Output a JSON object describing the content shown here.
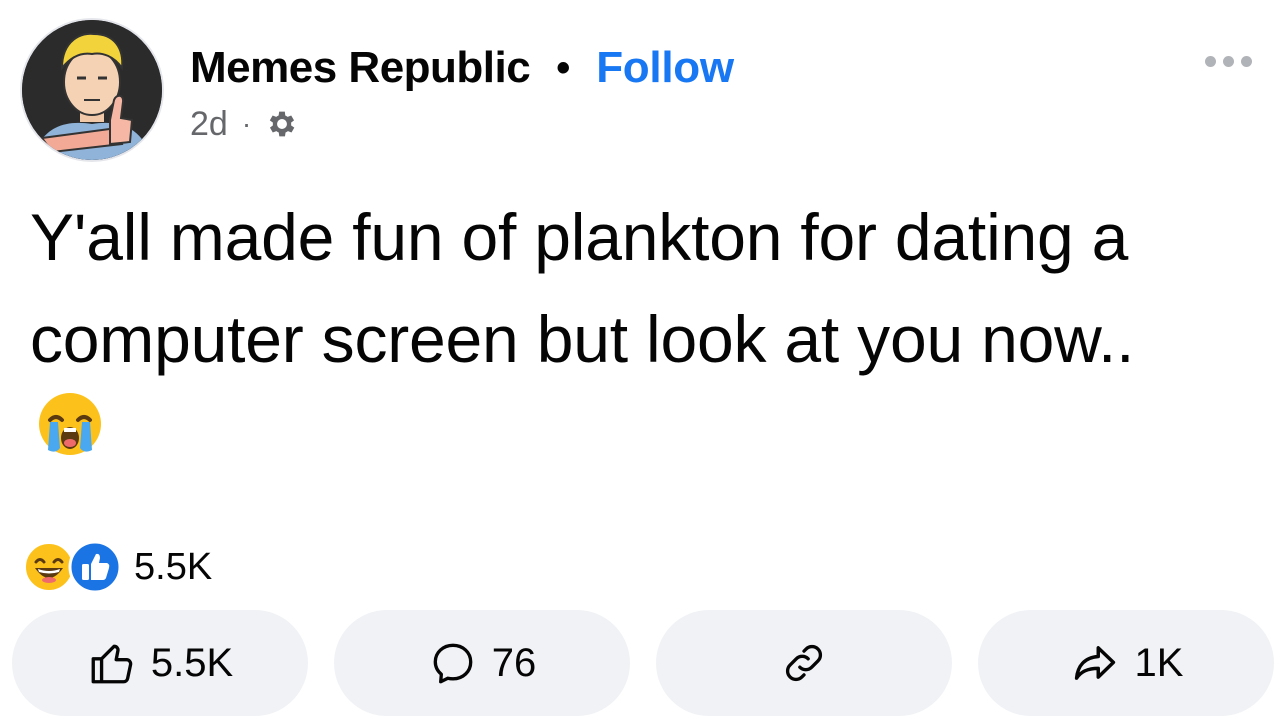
{
  "post": {
    "page_name": "Memes Republic",
    "separator": "•",
    "follow_label": "Follow",
    "time": "2d",
    "meta_separator": "·",
    "audience_icon": "gear-icon",
    "text_line1": "Y'all made fun of plankton for dating a",
    "text_line2": "computer screen but look at you now..",
    "emoji": "loudly-crying-face-emoji"
  },
  "reactions": {
    "icons": [
      "laughing-face-icon",
      "like-thumb-icon"
    ],
    "count": "5.5K"
  },
  "actions": [
    {
      "icon": "like-outline-icon",
      "label": "5.5K"
    },
    {
      "icon": "comment-bubble-icon",
      "label": "76"
    },
    {
      "icon": "link-icon",
      "label": ""
    },
    {
      "icon": "share-arrow-icon",
      "label": "1K"
    }
  ],
  "colors": {
    "accent": "#1877f2",
    "secondary_text": "#65676b",
    "button_bg": "#f0f2f5"
  }
}
